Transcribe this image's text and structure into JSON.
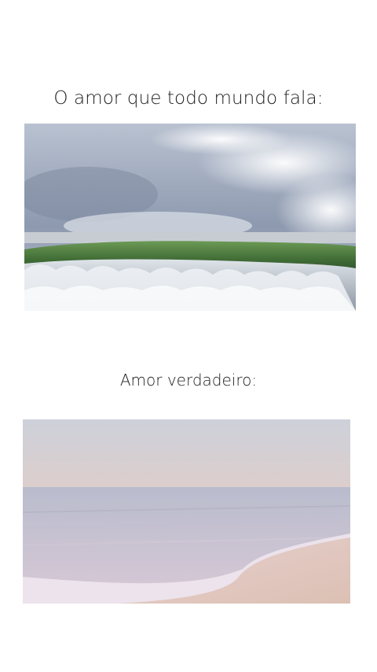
{
  "captions": {
    "top": "O amor que todo mundo fala:",
    "bottom": "Amor verdadeiro:"
  },
  "images": {
    "top": {
      "subject": "ocean-wave-photo",
      "colors": {
        "sky": "#8a97ad",
        "wave": "#4f7a3e",
        "foam": "#e8ecf0"
      }
    },
    "bottom": {
      "subject": "calm-beach-sunset-photo",
      "colors": {
        "sky": "#e9c9b7",
        "sea": "#c9c0d0",
        "sand": "#e2c8bd"
      }
    }
  }
}
